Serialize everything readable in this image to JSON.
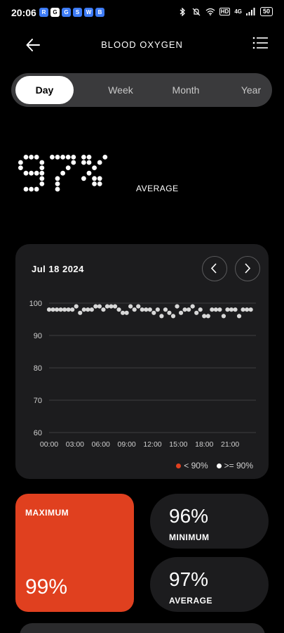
{
  "status_bar": {
    "time": "20:06",
    "app_icons": [
      "R",
      "G",
      "G",
      "S",
      "W",
      "B"
    ],
    "network": "4G",
    "hd": "HD",
    "battery": "50"
  },
  "header": {
    "title": "BLOOD OXYGEN"
  },
  "tabs": [
    {
      "label": "Day",
      "active": true
    },
    {
      "label": "Week",
      "active": false
    },
    {
      "label": "Month",
      "active": false
    },
    {
      "label": "Year",
      "active": false
    }
  ],
  "summary": {
    "value": "97%",
    "label": "AVERAGE"
  },
  "chart_card": {
    "date": "Jul 18  2024",
    "legend": [
      {
        "label": "< 90%",
        "color": "#e0401f"
      },
      {
        "label": ">= 90%",
        "color": "#ffffff"
      }
    ]
  },
  "chart_data": {
    "type": "scatter",
    "ylim": [
      60,
      100
    ],
    "yticks": [
      "100",
      "90",
      "80",
      "70",
      "60"
    ],
    "xticks": [
      "00:00",
      "03:00",
      "06:00",
      "09:00",
      "12:00",
      "15:00",
      "18:00",
      "21:00"
    ],
    "xlim_hours": [
      0,
      24
    ],
    "series": [
      {
        "name": ">= 90%",
        "color": "#d8d8d8",
        "x": [
          0.0,
          0.45,
          0.9,
          1.35,
          1.8,
          2.25,
          2.7,
          3.15,
          3.6,
          4.05,
          4.5,
          4.95,
          5.4,
          5.85,
          6.3,
          6.75,
          7.2,
          7.65,
          8.1,
          8.55,
          9.0,
          9.45,
          9.9,
          10.35,
          10.8,
          11.25,
          11.7,
          12.15,
          12.6,
          13.05,
          13.5,
          13.95,
          14.4,
          14.85,
          15.3,
          15.75,
          16.2,
          16.65,
          17.1,
          17.55,
          18.0,
          18.45,
          18.9,
          19.35,
          19.8,
          20.25,
          20.7,
          21.15,
          21.6,
          22.05,
          22.5,
          22.95,
          23.4
        ],
        "y": [
          98,
          98,
          98,
          98,
          98,
          98,
          98,
          99,
          97,
          98,
          98,
          98,
          99,
          99,
          98,
          99,
          99,
          99,
          98,
          97,
          97,
          99,
          98,
          99,
          98,
          98,
          98,
          97,
          98,
          96,
          98,
          97,
          96,
          99,
          97,
          98,
          98,
          99,
          97,
          98,
          96,
          96,
          98,
          98,
          98,
          96,
          98,
          98,
          98,
          96,
          98,
          98,
          98
        ]
      }
    ]
  },
  "stats": {
    "maximum": {
      "label": "MAXIMUM",
      "value": "99%"
    },
    "minimum": {
      "label": "MINIMUM",
      "value": "96%"
    },
    "average": {
      "label": "AVERAGE",
      "value": "97%"
    }
  },
  "colors": {
    "accent": "#e0401f",
    "card": "#1c1c1e",
    "background": "#000000"
  }
}
